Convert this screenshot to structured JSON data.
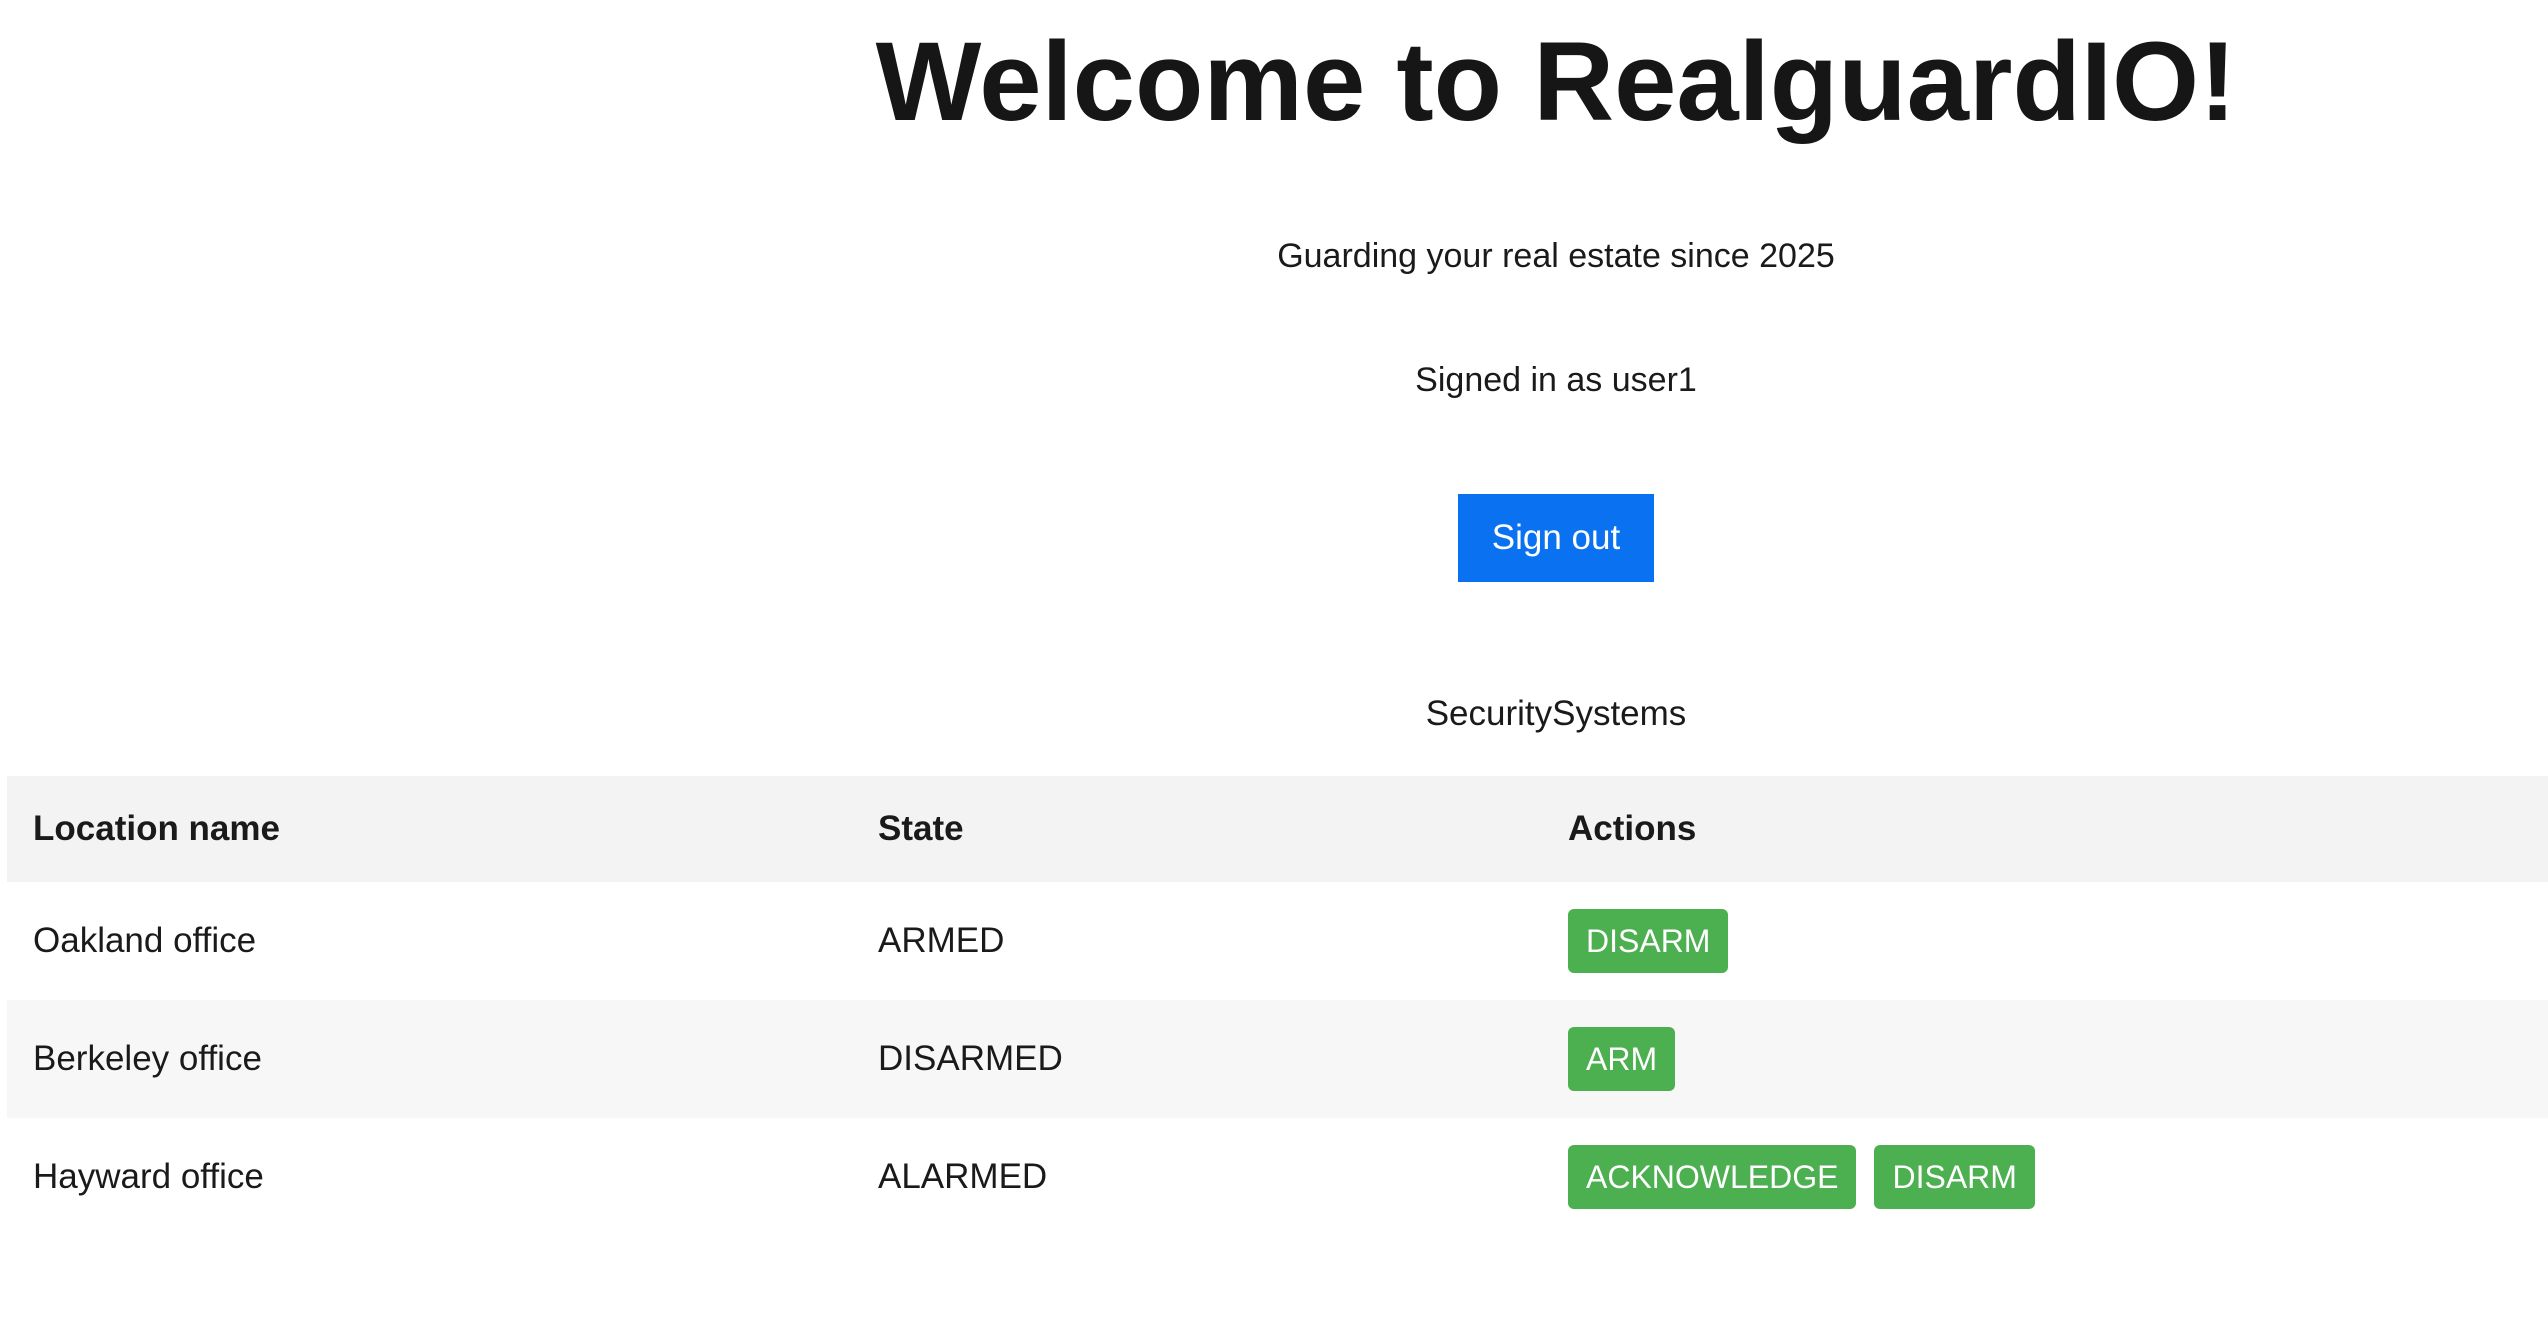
{
  "header": {
    "title": "Welcome to RealguardIO!",
    "subtitle": "Guarding your real estate since 2025",
    "signed_in_text": "Signed in as user1",
    "sign_out_label": "Sign out"
  },
  "colors": {
    "primary_button": "#0a72f0",
    "action_button": "#4caf50"
  },
  "security_systems": {
    "section_title": "SecuritySystems",
    "columns": [
      "Location name",
      "State",
      "Actions"
    ],
    "rows": [
      {
        "location": "Oakland office",
        "state": "ARMED",
        "actions": [
          "DISARM"
        ]
      },
      {
        "location": "Berkeley office",
        "state": "DISARMED",
        "actions": [
          "ARM"
        ]
      },
      {
        "location": "Hayward office",
        "state": "ALARMED",
        "actions": [
          "ACKNOWLEDGE",
          "DISARM"
        ]
      }
    ]
  }
}
